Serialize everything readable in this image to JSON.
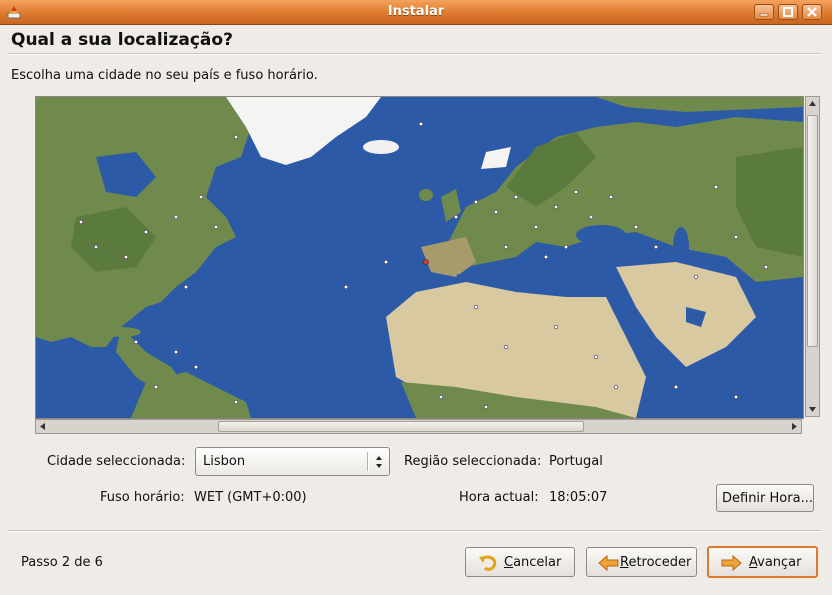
{
  "window": {
    "title": "Instalar",
    "buttons": [
      "minimize-icon",
      "maximize-icon",
      "close-icon"
    ]
  },
  "page": {
    "heading": "Qual a sua localização?",
    "instructions": "Escolha uma cidade no seu país e fuso horário."
  },
  "map": {
    "description_icon": "world-map",
    "colors": {
      "ocean": "#2d5aa7",
      "land": "#6f8a4c",
      "desert": "#d9c9a0",
      "ice": "#f4f4f2",
      "city_marker": "#ffffff"
    }
  },
  "form": {
    "city_label": "Cidade seleccionada:",
    "city_value": "Lisbon",
    "region_label": "Região seleccionada:",
    "region_value": "Portugal",
    "tz_label": "Fuso horário:",
    "tz_value": "WET (GMT+0:00)",
    "time_label": "Hora actual:",
    "time_value": "18:05:07",
    "set_time_button": "Definir Hora..."
  },
  "footer": {
    "step": "Passo 2 de 6",
    "cancel": {
      "mnemonic": "C",
      "rest": "ancelar"
    },
    "back": {
      "mnemonic": "R",
      "rest": "etroceder"
    },
    "forward": {
      "mnemonic": "A",
      "rest": "vançar"
    }
  },
  "colors": {
    "titlebar": "#dd7a2f",
    "accent": "#dd7a2f",
    "window_bg": "#efebe7"
  }
}
